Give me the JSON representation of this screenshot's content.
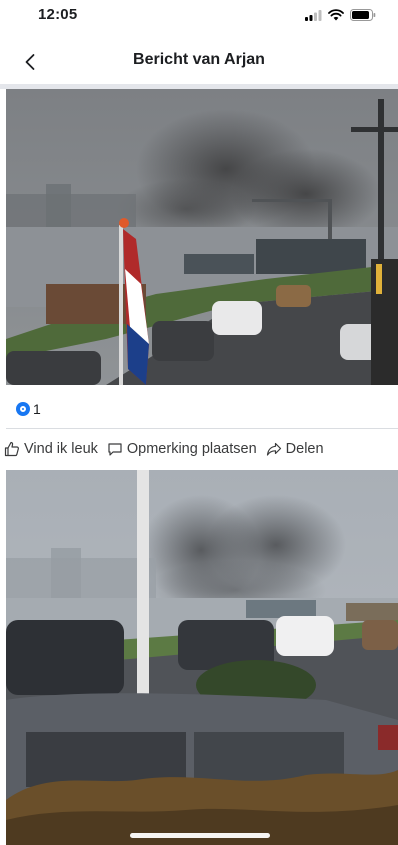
{
  "status_bar": {
    "time": "12:05",
    "icons": [
      "signal-icon",
      "wifi-icon",
      "battery-icon"
    ]
  },
  "nav": {
    "back_icon": "chevron-left-icon",
    "title": "Bericht van Arjan"
  },
  "post": {
    "photos": [
      {
        "description_icon": "photo-harbour-smoke",
        "kind": "photo"
      },
      {
        "description_icon": "photo-parking-smoke",
        "kind": "photo"
      }
    ],
    "reactions": {
      "icon": "like-reaction-icon",
      "count": "1"
    },
    "actions": [
      {
        "label": "Vind ik leuk",
        "icon": "thumbs-up-icon"
      },
      {
        "label": "Opmerking plaatsen",
        "icon": "comment-icon"
      },
      {
        "label": "Delen",
        "icon": "share-icon"
      }
    ]
  },
  "colors": {
    "accent": "#1877f2",
    "divider": "#e4e6eb",
    "text": "#1c1e21",
    "muted_text": "#3a3b3c"
  }
}
